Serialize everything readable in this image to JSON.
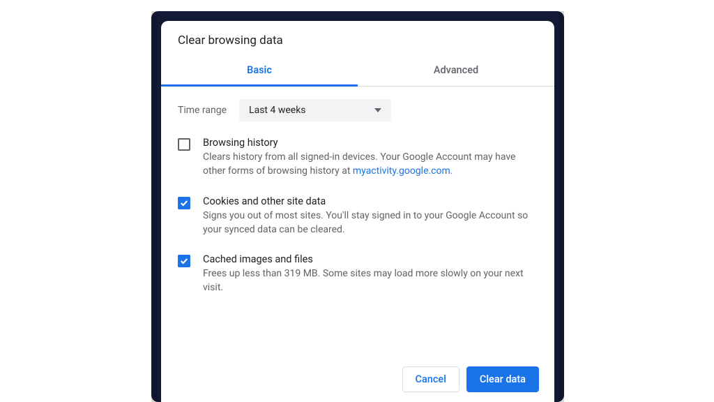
{
  "dialog": {
    "title": "Clear browsing data",
    "tabs": {
      "basic": "Basic",
      "advanced": "Advanced"
    },
    "time_range": {
      "label": "Time range",
      "selected": "Last 4 weeks"
    },
    "items": [
      {
        "title": "Browsing history",
        "desc_before": "Clears history from all signed-in devices. Your Google Account may have other forms of browsing history at ",
        "link": "myactivity.google.com",
        "desc_after": ".",
        "checked": false
      },
      {
        "title": "Cookies and other site data",
        "desc": "Signs you out of most sites. You'll stay signed in to your Google Account so your synced data can be cleared.",
        "checked": true
      },
      {
        "title": "Cached images and files",
        "desc": "Frees up less than 319 MB. Some sites may load more slowly on your next visit.",
        "checked": true
      }
    ],
    "buttons": {
      "cancel": "Cancel",
      "clear": "Clear data"
    }
  }
}
